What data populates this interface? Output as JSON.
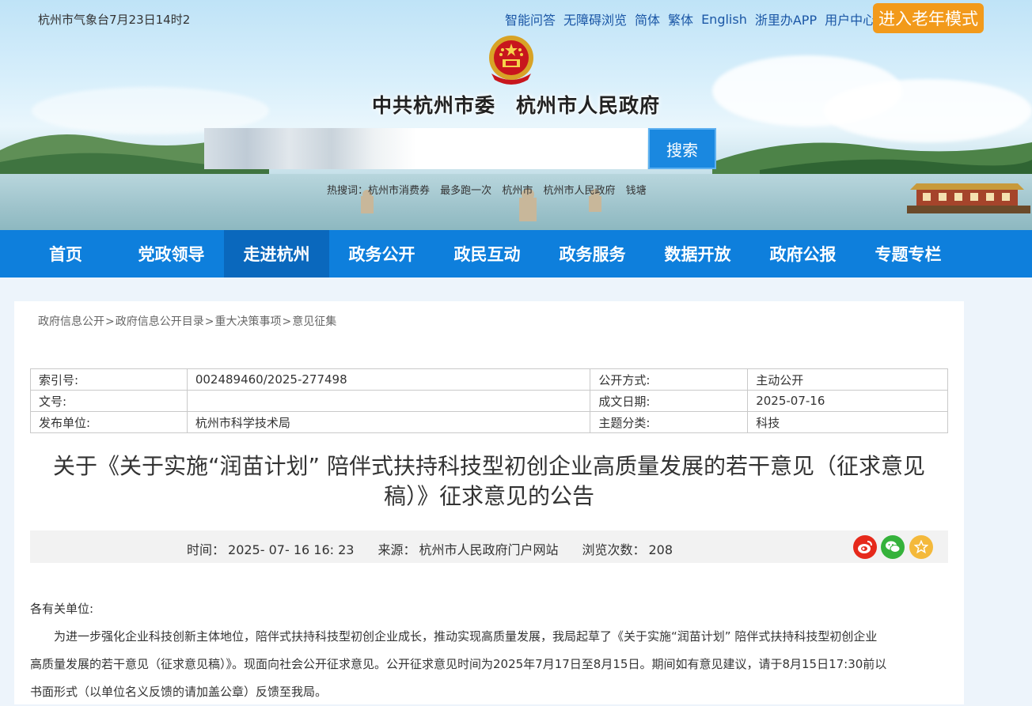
{
  "header": {
    "weather": "杭州市气象台7月23日14时2",
    "top_links": [
      "智能问答",
      "无障碍浏览",
      "简体",
      "繁体",
      "English",
      "浙里办APP",
      "用户中心"
    ],
    "elder_mode": "进入老年模式",
    "site_title": "中共杭州市委　杭州市人民政府",
    "search_button": "搜索",
    "search_placeholder": "",
    "hot_words": [
      "热搜词：杭州市消费券",
      "最多跑一次",
      "杭州市",
      "杭州市人民政府",
      "钱塘"
    ]
  },
  "nav": [
    "首页",
    "党政领导",
    "走进杭州",
    "政务公开",
    "政民互动",
    "政务服务",
    "数据开放",
    "政府公报",
    "专题专栏"
  ],
  "nav_active": "走进杭州",
  "breadcrumb": [
    "政府信息公开",
    "政府信息公开目录",
    "重大决策事项",
    "意见征集"
  ],
  "meta_table": {
    "index_label": "索引号:",
    "index_value": "002489460/2025-277498",
    "open_label": "公开方式:",
    "open_value": "主动公开",
    "docno_label": "文号:",
    "docno_value": "",
    "date_label": "成文日期:",
    "date_value": "2025-07-16",
    "publisher_label": "发布单位:",
    "publisher_value": "杭州市科学技术局",
    "topic_label": "主题分类:",
    "topic_value": "科技"
  },
  "doc_title_line1": "关于《关于实施“润苗计划” 陪伴式扶持科技型初创企业高质量发展的若干意见（征求意见",
  "doc_title_line2": "稿）》征求意见的公告",
  "info": {
    "time_label": "时间：",
    "time_value": "2025- 07- 16  16: 23",
    "source_label": "来源：",
    "source_value": "杭州市人民政府门户网站",
    "views_label": "浏览次数：",
    "views_value": "208"
  },
  "body": {
    "greeting": "各有关单位:",
    "para1": "为进一步强化企业科技创新主体地位，陪伴式扶持科技型初创企业成长，推动实现高质量发展，我局起草了《关于实施“润苗计划” 陪伴式扶持科技型初创企业",
    "para2": "高质量发展的若干意见（征求意见稿）》。现面向社会公开征求意见。公开征求意见时间为2025年7月17日至8月15日。期间如有意见建议，请于8月15日17:30前以",
    "para3": "书面形式（以单位名义反馈的请加盖公章）反馈至我局。"
  },
  "colors": {
    "nav": "#0e7fdc",
    "nav_active": "#0a68bd",
    "elder": "#f29a1b",
    "weibo": "#e6291b",
    "wechat": "#35b23b",
    "favorite": "#f4b93b"
  },
  "icons": [
    "national-emblem-icon",
    "weibo-icon",
    "wechat-icon",
    "favorite-star-icon"
  ]
}
